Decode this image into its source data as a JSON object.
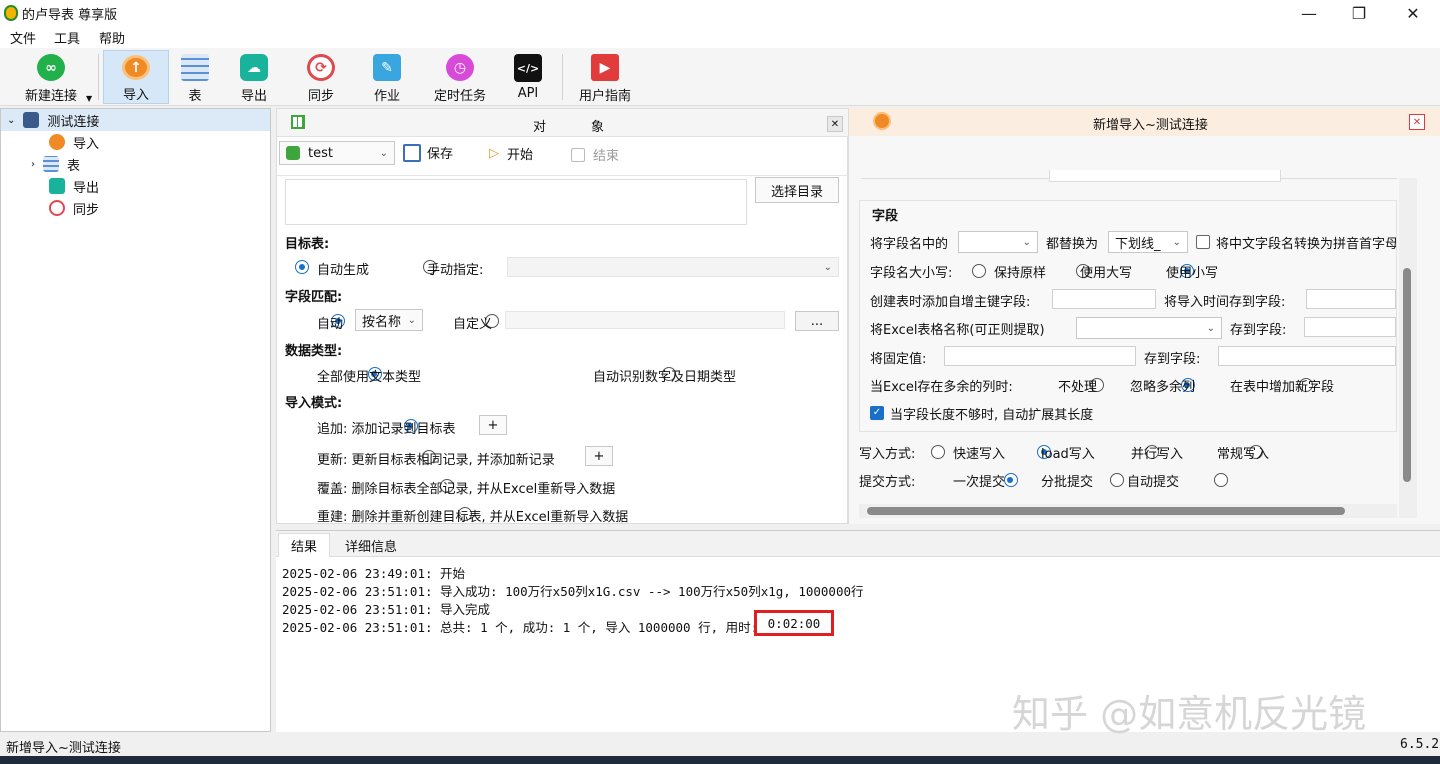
{
  "window": {
    "title": "的卢导表 尊享版",
    "minimize": "—",
    "maximize": "❐",
    "close": "✕"
  },
  "menu": [
    "文件",
    "工具",
    "帮助"
  ],
  "toolbar": {
    "new_connection": "新建连接",
    "import": "导入",
    "table": "表",
    "export": "导出",
    "sync": "同步",
    "job": "作业",
    "scheduled_task": "定时任务",
    "api": "API",
    "user_guide": "用户指南"
  },
  "tree": {
    "root": "测试连接",
    "children": [
      "导入",
      "表",
      "导出",
      "同步"
    ]
  },
  "middle": {
    "header": {
      "col1": "对",
      "col2": "象"
    },
    "db_select": "test",
    "save": "保存",
    "start": "开始",
    "end": "结束",
    "choose_dir": "选择目录",
    "target_table_label": "目标表:",
    "auto_generate": "自动生成",
    "manual_specify": "手动指定:",
    "field_match_label": "字段匹配:",
    "auto": "自动",
    "by_name": "按名称",
    "custom": "自定义",
    "ellipsis": "...",
    "data_type_label": "数据类型:",
    "all_text": "全部使用文本类型",
    "auto_detect": "自动识别数字及日期类型",
    "import_mode_label": "导入模式:",
    "mode_append": "追加: 添加记录到目标表",
    "mode_update": "更新: 更新目标表相同记录, 并添加新记录",
    "mode_overwrite": "覆盖: 删除目标表全部记录, 并从Excel重新导入数据",
    "mode_rebuild": "重建: 删除并重新创建目标表, 并从Excel重新导入数据",
    "plus": "+"
  },
  "right": {
    "title": "新增导入~测试连接",
    "fields_title": "字段",
    "replace_label": "将字段名中的",
    "replace_with_label": "都替换为",
    "replace_with_value": "下划线_",
    "pinyin_label": "将中文字段名转换为拼音首字母",
    "case_label": "字段名大小写:",
    "case_keep": "保持原样",
    "case_upper": "使用大写",
    "case_lower": "使用小写",
    "auto_pk_label": "创建表时添加自增主键字段:",
    "import_time_label": "将导入时间存到字段:",
    "sheet_name_label": "将Excel表格名称(可正则提取)",
    "store_to_field": "存到字段:",
    "fixed_value_label": "将固定值:",
    "extra_cols_label": "当Excel存在多余的列时:",
    "extra_ignore": "不处理",
    "extra_skip": "忽略多余列",
    "extra_add": "在表中增加新字段",
    "expand_len_label": "当字段长度不够时, 自动扩展其长度",
    "write_mode_label": "写入方式:",
    "write_fast": "快速写入",
    "write_load": "load写入",
    "write_parallel": "并行写入",
    "write_normal": "常规写入",
    "commit_label": "提交方式:",
    "commit_once": "一次提交",
    "commit_batch": "分批提交",
    "commit_auto": "自动提交"
  },
  "bottom": {
    "tabs": [
      "结果",
      "详细信息"
    ],
    "log": [
      "2025-02-06 23:49:01: 开始",
      "2025-02-06 23:51:01: 导入成功: 100万行x50列x1G.csv --> 100万行x50列x1g, 1000000行",
      "2025-02-06 23:51:01: 导入完成",
      "2025-02-06 23:51:01: 总共: 1 个, 成功: 1 个, 导入 1000000 行, 用时:"
    ],
    "elapsed": "0:02:00",
    "watermark": "知乎 @如意机反光镜"
  },
  "status": {
    "left": "新增导入~测试连接",
    "version": "6.5.2"
  },
  "colors": {
    "accent": "#1a6fc9",
    "highlight_box": "#e02020",
    "orange_icon": "#f08a24",
    "teal_icon": "#19b29a",
    "green_icon": "#22b04b"
  }
}
